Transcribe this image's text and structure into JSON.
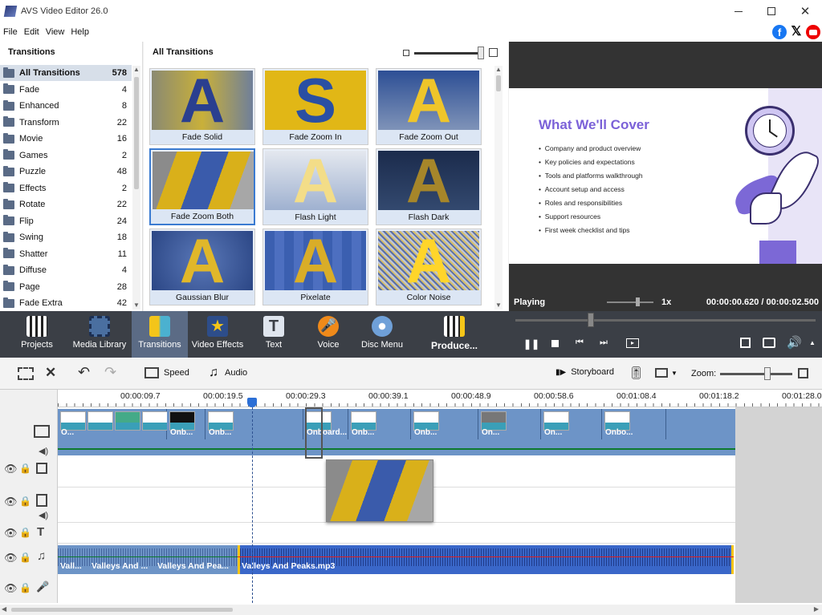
{
  "window": {
    "title": "AVS Video Editor 26.0"
  },
  "menu": [
    "File",
    "Edit",
    "View",
    "Help"
  ],
  "social": [
    "facebook-icon",
    "x-icon",
    "youtube-icon"
  ],
  "categories": {
    "header": "Transitions",
    "items": [
      {
        "label": "All Transitions",
        "count": "578"
      },
      {
        "label": "Fade",
        "count": "4"
      },
      {
        "label": "Enhanced",
        "count": "8"
      },
      {
        "label": "Transform",
        "count": "22"
      },
      {
        "label": "Movie",
        "count": "16"
      },
      {
        "label": "Games",
        "count": "2"
      },
      {
        "label": "Puzzle",
        "count": "48"
      },
      {
        "label": "Effects",
        "count": "2"
      },
      {
        "label": "Rotate",
        "count": "22"
      },
      {
        "label": "Flip",
        "count": "24"
      },
      {
        "label": "Swing",
        "count": "18"
      },
      {
        "label": "Shatter",
        "count": "11"
      },
      {
        "label": "Diffuse",
        "count": "4"
      },
      {
        "label": "Page",
        "count": "28"
      },
      {
        "label": "Fade Extra",
        "count": "42"
      }
    ]
  },
  "gallery": {
    "header": "All Transitions",
    "items": [
      {
        "label": "Fade Solid",
        "letter": "A"
      },
      {
        "label": "Fade Zoom In",
        "letter": "S"
      },
      {
        "label": "Fade Zoom Out",
        "letter": "A"
      },
      {
        "label": "Fade Zoom Both",
        "letter": ""
      },
      {
        "label": "Flash Light",
        "letter": "A"
      },
      {
        "label": "Flash Dark",
        "letter": "A"
      },
      {
        "label": "Gaussian Blur",
        "letter": "A"
      },
      {
        "label": "Pixelate",
        "letter": "A"
      },
      {
        "label": "Color Noise",
        "letter": "A"
      }
    ]
  },
  "slide": {
    "title": "What We'll Cover",
    "bullets": [
      "Company and product overview",
      "Key policies and expectations",
      "Tools and platforms walkthrough",
      "Account setup and access",
      "Roles and responsibilities",
      "Support resources",
      "First week checklist and tips"
    ]
  },
  "player": {
    "status": "Playing",
    "speed": "1x",
    "current": "00:00:00.620",
    "separator": "/",
    "total": "00:00:02.500",
    "position_fraction": 0.25
  },
  "toolbar": {
    "items": [
      {
        "label": "Projects"
      },
      {
        "label": "Media Library"
      },
      {
        "label": "Transitions"
      },
      {
        "label": "Video Effects"
      },
      {
        "label": "Text"
      },
      {
        "label": "Voice"
      },
      {
        "label": "Disc Menu"
      },
      {
        "label": "Produce..."
      }
    ]
  },
  "timeline_toolbar": {
    "speed": "Speed",
    "audio": "Audio",
    "storyboard": "Storyboard",
    "zoom": "Zoom:"
  },
  "ruler": [
    "00:00:09.7",
    "00:00:19.5",
    "00:00:29.3",
    "00:00:39.1",
    "00:00:48.9",
    "00:00:58.6",
    "00:01:08.4",
    "00:01:18.2",
    "00:01:28.0"
  ],
  "video_clips": [
    "O...",
    "Onb...",
    "Onb...",
    "Onboard...",
    "Onb...",
    "Onb...",
    "On...",
    "On...",
    "Onbo..."
  ],
  "audio_clips": [
    "Vall...",
    "Valleys And ...",
    "Valleys And Pea...",
    "Valleys And Peaks.mp3"
  ],
  "colors": {
    "accent": "#6d94c7",
    "title": "#7b61d8",
    "toolbar": "#3b3f46",
    "audio": "#3a67c9"
  }
}
